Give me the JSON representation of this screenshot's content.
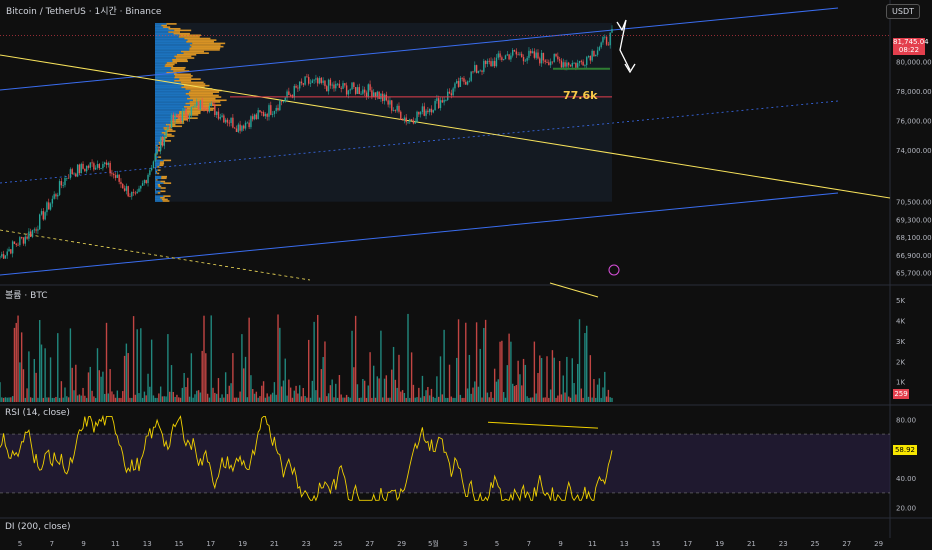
{
  "header": {
    "symbol_title": "Bitcoin / TetherUS · 1시간 · Binance",
    "currency_button": "USDT",
    "last_price": "81,745.04",
    "countdown": "08:22"
  },
  "colors": {
    "background": "#0f0f0f",
    "up": "#26a69a",
    "down": "#ef5350",
    "channel": "#3a6df0",
    "trendline": "#f7e25b",
    "resistance": "#e33f4d",
    "support": "#2e7d32",
    "rsi": "#f0d000",
    "profile_up": "#1e88e5",
    "profile_down": "#f9a825"
  },
  "price_axis": {
    "ticks": [
      "81,745.04",
      "80,000.00",
      "78,000.00",
      "76,000.00",
      "74,000.00",
      "70,500.00",
      "69,300.00",
      "68,100.00",
      "66,900.00",
      "65,700.00"
    ]
  },
  "time_axis": {
    "ticks": [
      "5",
      "7",
      "9",
      "11",
      "13",
      "15",
      "17",
      "19",
      "21",
      "23",
      "25",
      "27",
      "29",
      "5월",
      "3",
      "5",
      "7",
      "9",
      "11",
      "13",
      "15",
      "17",
      "19",
      "21",
      "23",
      "25",
      "27",
      "29"
    ]
  },
  "volume_pane": {
    "label": "볼륨 · BTC",
    "ticks": [
      "5K",
      "4K",
      "3K",
      "2K",
      "1K"
    ],
    "last_value": "259"
  },
  "rsi_pane": {
    "label": "RSI (14, close)",
    "ticks": [
      "80.00",
      "40.00",
      "20.00"
    ],
    "last_value": "58.92"
  },
  "di_pane": {
    "label": "DI (200, close)"
  },
  "annotation": {
    "level_label": "77.6k",
    "flash_icon": "lightning-icon"
  },
  "chart_data": {
    "type": "line",
    "title": "",
    "xlabel": "",
    "ylabel": "",
    "x": [
      "5",
      "7",
      "9",
      "11",
      "13",
      "15",
      "17",
      "19",
      "21",
      "23",
      "25",
      "27",
      "29",
      "5월",
      "3",
      "5",
      "7",
      "9",
      "11"
    ],
    "series": [
      {
        "values": [
          66800,
          68600,
          72400,
          73200,
          70600,
          75900,
          77200,
          75600,
          76800,
          78600,
          78200,
          78000,
          76000,
          77400,
          79400,
          80500,
          80200,
          79800,
          81745
        ]
      }
    ],
    "ylim": [
      65200,
      82800
    ],
    "levels": {
      "resistance": 77600,
      "support": 79500
    },
    "volume": {
      "ylim": [
        0,
        5500
      ],
      "last": 259
    },
    "rsi": {
      "ylim": [
        15,
        85
      ],
      "bands": [
        70,
        30
      ],
      "last": 58.92
    }
  }
}
